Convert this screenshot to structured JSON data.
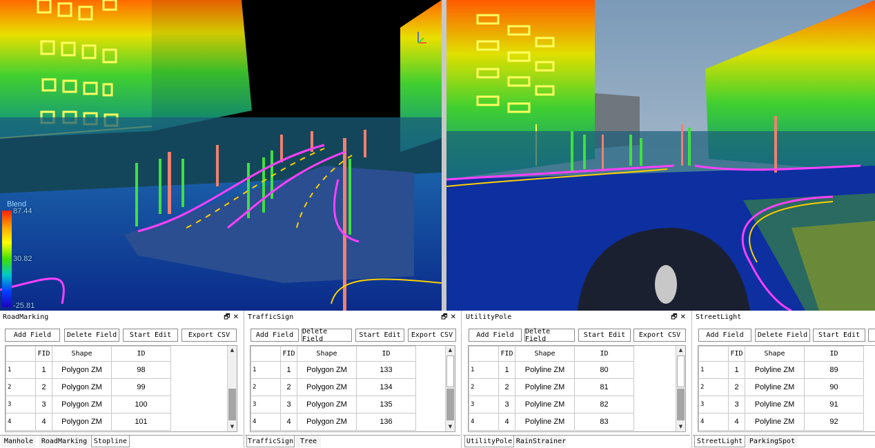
{
  "viewer": {
    "legend": {
      "title": "Blend",
      "max": "87.44",
      "mid": "30.82",
      "min": "-25.81"
    }
  },
  "panels": [
    {
      "title": "RoadMarking",
      "buttons": [
        "Add Field",
        "Delete  Field",
        "Start Edit",
        "Export CSV"
      ],
      "columns": [
        "",
        "FID",
        "Shape",
        "ID"
      ],
      "rows": [
        [
          "1",
          "1",
          "Polygon ZM",
          "98"
        ],
        [
          "2",
          "2",
          "Polygon ZM",
          "99"
        ],
        [
          "3",
          "3",
          "Polygon ZM",
          "100"
        ],
        [
          "4",
          "4",
          "Polygon ZM",
          "101"
        ]
      ],
      "tabs": [
        "Manhole",
        "RoadMarking",
        "Stopline"
      ],
      "active_tab": 2
    },
    {
      "title": "TrafficSign",
      "buttons": [
        "Add Field",
        "Delete  Field",
        "Start Edit",
        "Export CSV"
      ],
      "columns": [
        "",
        "FID",
        "Shape",
        "ID"
      ],
      "rows": [
        [
          "1",
          "1",
          "Polygon ZM",
          "133"
        ],
        [
          "2",
          "2",
          "Polygon ZM",
          "134"
        ],
        [
          "3",
          "3",
          "Polygon ZM",
          "135"
        ],
        [
          "4",
          "4",
          "Polygon ZM",
          "136"
        ]
      ],
      "tabs": [
        "TrafficSign",
        "Tree"
      ],
      "active_tab": 0
    },
    {
      "title": "UtilityPole",
      "buttons": [
        "Add Field",
        "Delete  Field",
        "Start Edit",
        "Export CSV"
      ],
      "columns": [
        "",
        "FID",
        "Shape",
        "ID"
      ],
      "rows": [
        [
          "1",
          "1",
          "Polyline ZM",
          "80"
        ],
        [
          "2",
          "2",
          "Polyline ZM",
          "81"
        ],
        [
          "3",
          "3",
          "Polyline ZM",
          "82"
        ],
        [
          "4",
          "4",
          "Polyline ZM",
          "83"
        ]
      ],
      "tabs": [
        "UtilityPole",
        "RainStrainer"
      ],
      "active_tab": 0
    },
    {
      "title": "StreetLight",
      "buttons": [
        "Add Field",
        "Delete  Field",
        "Start Edit"
      ],
      "columns": [
        "",
        "FID",
        "Shape",
        "ID"
      ],
      "rows": [
        [
          "1",
          "1",
          "Polyline ZM",
          "89"
        ],
        [
          "2",
          "2",
          "Polyline ZM",
          "90"
        ],
        [
          "3",
          "3",
          "Polyline ZM",
          "91"
        ],
        [
          "4",
          "4",
          "Polyline ZM",
          "92"
        ]
      ],
      "tabs": [
        "StreetLight",
        "ParkingSpot"
      ],
      "active_tab": 0
    }
  ],
  "icons": {
    "float": "restore-icon",
    "close": "close-icon"
  }
}
